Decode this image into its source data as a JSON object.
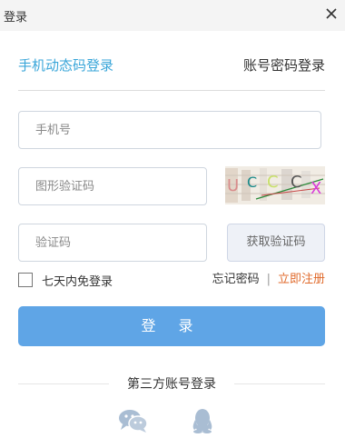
{
  "window": {
    "title": "登录"
  },
  "tabs": {
    "active": "手机动态码登录",
    "inactive": "账号密码登录"
  },
  "fields": {
    "phone_placeholder": "手机号",
    "captcha_placeholder": "图形验证码",
    "code_placeholder": "验证码"
  },
  "captcha_text": "UCCCX",
  "buttons": {
    "get_code": "获取验证码",
    "login": "登 录"
  },
  "remember": {
    "label": "七天内免登录"
  },
  "links": {
    "forgot": "忘记密码",
    "separator": "|",
    "register": "立即注册"
  },
  "third_party": {
    "label": "第三方账号登录"
  },
  "colors": {
    "accent": "#3aa6d9",
    "login_button": "#5fa5e6",
    "register_link": "#e06a2b"
  }
}
